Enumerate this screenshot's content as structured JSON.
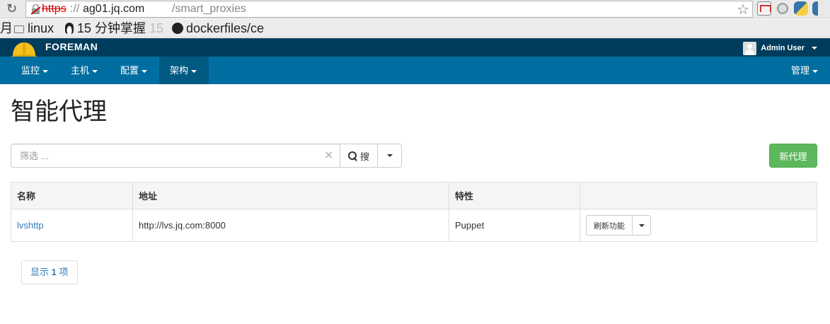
{
  "browser": {
    "url_scheme": "https",
    "url_separator": "://",
    "url_host": "ag01.jq.com",
    "url_path": "/smart_proxies",
    "bookmarks": [
      {
        "label": "月",
        "icon": "cut-off"
      },
      {
        "label": "linux",
        "icon": "folder-icon"
      },
      {
        "label": "15 分钟掌握",
        "suffix": "15",
        "icon": "penguin-icon"
      },
      {
        "label": "dockerfiles/ce",
        "icon": "github-icon"
      }
    ]
  },
  "topbar": {
    "brand": "FOREMAN",
    "user": "Admin User"
  },
  "nav": {
    "items": [
      {
        "label": "监控"
      },
      {
        "label": "主机"
      },
      {
        "label": "配置"
      },
      {
        "label": "架构",
        "active": true
      }
    ],
    "admin": "管理"
  },
  "page": {
    "title": "智能代理",
    "search_placeholder": "筛选 ...",
    "clear": "×",
    "search_button": "搜",
    "new_button": "新代理"
  },
  "table": {
    "columns": [
      "名称",
      "地址",
      "特性",
      ""
    ],
    "rows": [
      {
        "name": "lvshttp",
        "url": "http://lvs.jq.com:8000",
        "features": "Puppet",
        "action": "刷新功能"
      }
    ]
  },
  "pagination": {
    "prefix": "显示",
    "count": "1",
    "suffix": "项"
  },
  "colors": {
    "topbar": "#003d5c",
    "navbar": "#006ea0",
    "nav_active": "#005a82",
    "primary_action": "#5cb85c",
    "link": "#337ab7"
  }
}
